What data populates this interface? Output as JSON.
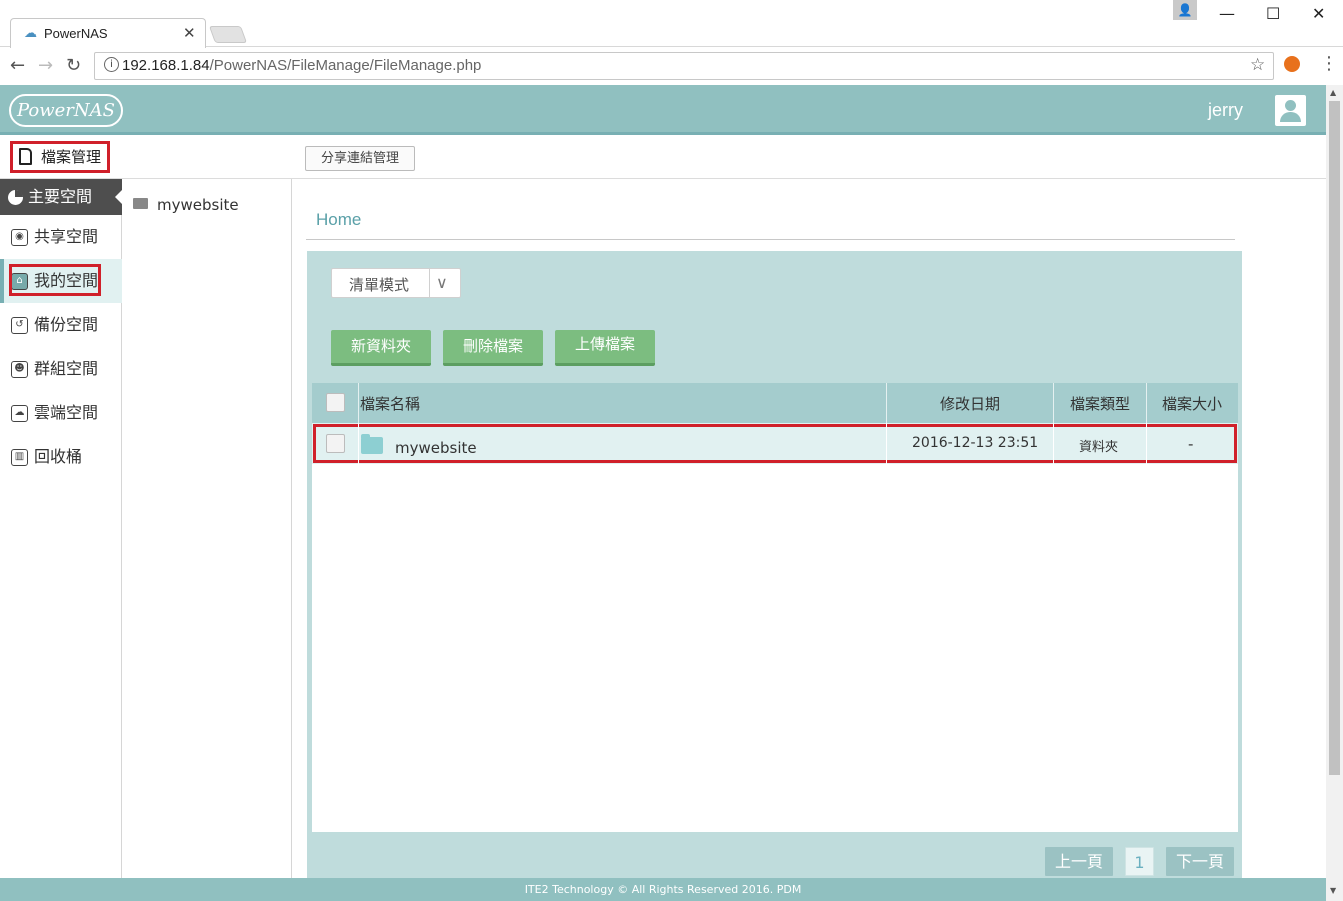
{
  "browser": {
    "tab_title": "PowerNAS",
    "url_host": "192.168.1.84",
    "url_path": "/PowerNAS/FileManage/FileManage.php"
  },
  "header": {
    "logo_text": "PowerNAS",
    "user_name": "jerry"
  },
  "subbar": {
    "title": "檔案管理",
    "share_button": "分享連結管理"
  },
  "sidebar": {
    "main": "主要空間",
    "items": [
      {
        "label": "共享空間",
        "icon": "globe-icon"
      },
      {
        "label": "我的空間",
        "icon": "home-icon"
      },
      {
        "label": "備份空間",
        "icon": "backup-icon"
      },
      {
        "label": "群組空間",
        "icon": "group-icon"
      },
      {
        "label": "雲端空間",
        "icon": "cloud-icon"
      },
      {
        "label": "回收桶",
        "icon": "trash-icon"
      }
    ]
  },
  "tree": {
    "folder": "mywebsite"
  },
  "breadcrumb": "Home",
  "toolbar": {
    "view_mode": "清單模式",
    "new_folder": "新資料夾",
    "delete_files": "刪除檔案",
    "upload_files": "上傳檔案"
  },
  "table": {
    "columns": [
      "檔案名稱",
      "修改日期",
      "檔案類型",
      "檔案大小"
    ],
    "rows": [
      {
        "name": "mywebsite",
        "date": "2016-12-13 23:51",
        "type": "資料夾",
        "size": "-"
      }
    ]
  },
  "pagination": {
    "prev": "上一頁",
    "page": "1",
    "next": "下一頁"
  },
  "footer": "ITE2 Technology © All Rights Reserved 2016. PDM",
  "colors": {
    "header": "#90c0c0",
    "green_button": "#7cbd80",
    "highlight_red": "#d0202a"
  }
}
